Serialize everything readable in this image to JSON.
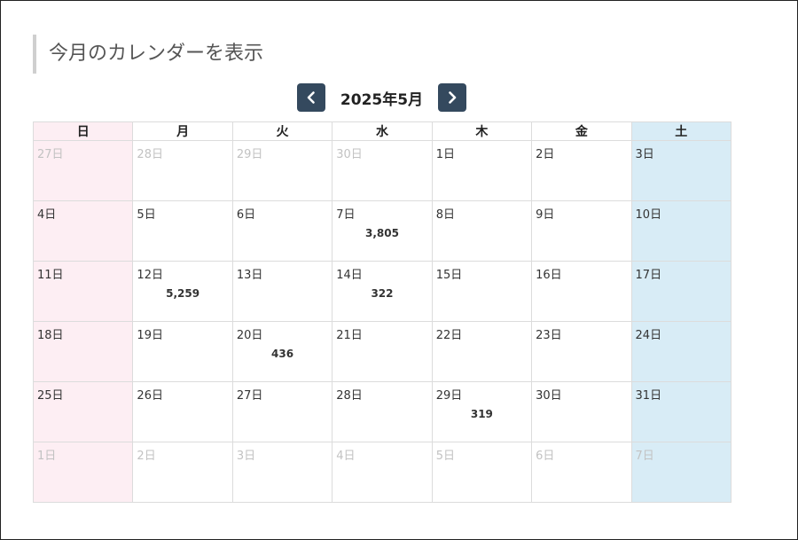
{
  "page_title": "今月のカレンダーを表示",
  "nav": {
    "month_label": "2025年5月",
    "prev_icon": "chevron-left-icon",
    "next_icon": "chevron-right-icon"
  },
  "weekdays": [
    "日",
    "月",
    "火",
    "水",
    "木",
    "金",
    "土"
  ],
  "weeks": [
    [
      {
        "day": "27日",
        "count": "",
        "other": true
      },
      {
        "day": "28日",
        "count": "",
        "other": true
      },
      {
        "day": "29日",
        "count": "",
        "other": true
      },
      {
        "day": "30日",
        "count": "",
        "other": true
      },
      {
        "day": "1日",
        "count": "",
        "other": false
      },
      {
        "day": "2日",
        "count": "",
        "other": false
      },
      {
        "day": "3日",
        "count": "",
        "other": false
      }
    ],
    [
      {
        "day": "4日",
        "count": "",
        "other": false
      },
      {
        "day": "5日",
        "count": "",
        "other": false
      },
      {
        "day": "6日",
        "count": "",
        "other": false
      },
      {
        "day": "7日",
        "count": "3,805",
        "other": false
      },
      {
        "day": "8日",
        "count": "",
        "other": false
      },
      {
        "day": "9日",
        "count": "",
        "other": false
      },
      {
        "day": "10日",
        "count": "",
        "other": false
      }
    ],
    [
      {
        "day": "11日",
        "count": "",
        "other": false
      },
      {
        "day": "12日",
        "count": "5,259",
        "other": false
      },
      {
        "day": "13日",
        "count": "",
        "other": false
      },
      {
        "day": "14日",
        "count": "322",
        "other": false
      },
      {
        "day": "15日",
        "count": "",
        "other": false
      },
      {
        "day": "16日",
        "count": "",
        "other": false
      },
      {
        "day": "17日",
        "count": "",
        "other": false
      }
    ],
    [
      {
        "day": "18日",
        "count": "",
        "other": false
      },
      {
        "day": "19日",
        "count": "",
        "other": false
      },
      {
        "day": "20日",
        "count": "436",
        "other": false
      },
      {
        "day": "21日",
        "count": "",
        "other": false
      },
      {
        "day": "22日",
        "count": "",
        "other": false
      },
      {
        "day": "23日",
        "count": "",
        "other": false
      },
      {
        "day": "24日",
        "count": "",
        "other": false
      }
    ],
    [
      {
        "day": "25日",
        "count": "",
        "other": false
      },
      {
        "day": "26日",
        "count": "",
        "other": false
      },
      {
        "day": "27日",
        "count": "",
        "other": false
      },
      {
        "day": "28日",
        "count": "",
        "other": false
      },
      {
        "day": "29日",
        "count": "319",
        "other": false
      },
      {
        "day": "30日",
        "count": "",
        "other": false
      },
      {
        "day": "31日",
        "count": "",
        "other": false
      }
    ],
    [
      {
        "day": "1日",
        "count": "",
        "other": true
      },
      {
        "day": "2日",
        "count": "",
        "other": true
      },
      {
        "day": "3日",
        "count": "",
        "other": true
      },
      {
        "day": "4日",
        "count": "",
        "other": true
      },
      {
        "day": "5日",
        "count": "",
        "other": true
      },
      {
        "day": "6日",
        "count": "",
        "other": true
      },
      {
        "day": "7日",
        "count": "",
        "other": true
      }
    ]
  ],
  "colors": {
    "nav_button": "#34495e",
    "sunday_bg": "#fdeef3",
    "saturday_bg": "#d8ecf6",
    "other_month_text": "#c2c2c2"
  }
}
